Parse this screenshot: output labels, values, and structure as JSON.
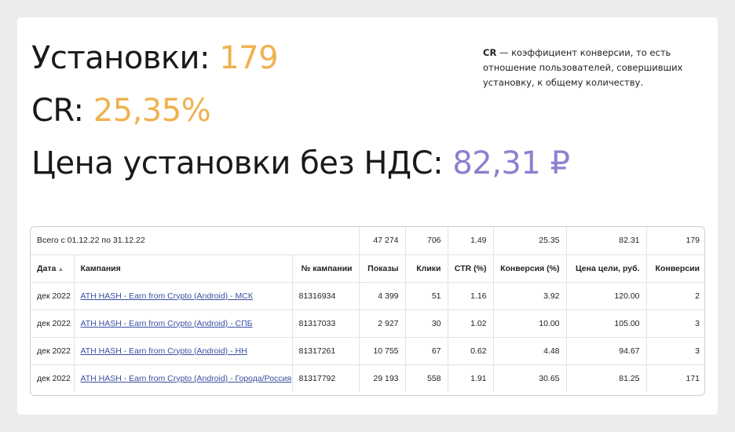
{
  "metrics": {
    "installs_label": "Установки: ",
    "installs_value": "179",
    "cr_label": "CR: ",
    "cr_value": "25,35%",
    "price_label": "Цена установки без НДС: ",
    "price_value": "82,31 ₽"
  },
  "note": {
    "term": "CR",
    "text": " — коэффициент конверсии, то есть отношение пользователей, совершивших установку, к общему количеству."
  },
  "table": {
    "total": {
      "label": "Всего с 01.12.22 по 31.12.22",
      "shows": "47 274",
      "clicks": "706",
      "ctr": "1.49",
      "conversion": "25.35",
      "goal_price": "82.31",
      "conversions": "179"
    },
    "headers": {
      "date": "Дата",
      "campaign": "Кампания",
      "campaign_no": "№ кампании",
      "shows": "Показы",
      "clicks": "Клики",
      "ctr": "CTR (%)",
      "conversion": "Конверсия (%)",
      "goal_price": "Цена цели, руб.",
      "conversions": "Конверсии"
    },
    "sort_icon": "triangle-up-icon",
    "rows": [
      {
        "date": "дек 2022",
        "campaign": "ATH HASH - Earn from Crypto (Android) - МСК",
        "campaign_no": "81316934",
        "shows": "4 399",
        "clicks": "51",
        "ctr": "1.16",
        "conversion": "3.92",
        "goal_price": "120.00",
        "conversions": "2"
      },
      {
        "date": "дек 2022",
        "campaign": "ATH HASH - Earn from Crypto (Android) - СПБ",
        "campaign_no": "81317033",
        "shows": "2 927",
        "clicks": "30",
        "ctr": "1.02",
        "conversion": "10.00",
        "goal_price": "105.00",
        "conversions": "3"
      },
      {
        "date": "дек 2022",
        "campaign": "ATH HASH - Earn from Crypto (Android) - НН",
        "campaign_no": "81317261",
        "shows": "10 755",
        "clicks": "67",
        "ctr": "0.62",
        "conversion": "4.48",
        "goal_price": "94.67",
        "conversions": "3"
      },
      {
        "date": "дек 2022",
        "campaign": "ATH HASH - Earn from Crypto (Android) - Города/Россия",
        "campaign_no": "81317792",
        "shows": "29 193",
        "clicks": "558",
        "ctr": "1.91",
        "conversion": "30.65",
        "goal_price": "81.25",
        "conversions": "171"
      }
    ]
  },
  "colors": {
    "orange": "#f0b14f",
    "purple": "#8a82cf",
    "link": "#3a4fa0"
  }
}
